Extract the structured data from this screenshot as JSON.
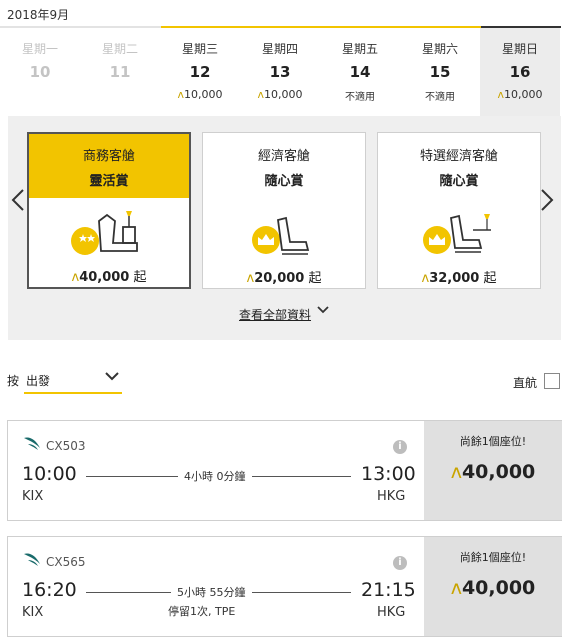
{
  "calendar": {
    "month": "2018年9月",
    "days": [
      {
        "name": "星期一",
        "num": "10",
        "price": "",
        "disabled": true
      },
      {
        "name": "星期二",
        "num": "11",
        "price": "",
        "disabled": true
      },
      {
        "name": "星期三",
        "num": "12",
        "price": "10,000",
        "disabled": false
      },
      {
        "name": "星期四",
        "num": "13",
        "price": "10,000",
        "disabled": false
      },
      {
        "name": "星期五",
        "num": "14",
        "price": "不適用",
        "disabled": false
      },
      {
        "name": "星期六",
        "num": "15",
        "price": "不適用",
        "disabled": false
      },
      {
        "name": "星期日",
        "num": "16",
        "price": "10,000",
        "disabled": false
      }
    ]
  },
  "cabins": [
    {
      "name": "商務客艙",
      "award": "靈活賞",
      "price": "40,000",
      "suffix": "起",
      "icon": "business-seat-star-icon"
    },
    {
      "name": "經濟客艙",
      "award": "隨心賞",
      "price": "20,000",
      "suffix": "起",
      "icon": "economy-seat-crown-icon"
    },
    {
      "name": "特選經濟客艙",
      "award": "隨心賞",
      "price": "32,000",
      "suffix": "起",
      "icon": "premium-economy-seat-crown-icon"
    }
  ],
  "view_all": "查看全部資料",
  "sort": {
    "label": "按",
    "value": "出發"
  },
  "nonstop": {
    "label": "直航"
  },
  "flights": [
    {
      "number": "CX503",
      "dep_time": "10:00",
      "dep_code": "KIX",
      "arr_time": "13:00",
      "arr_code": "HKG",
      "duration": "4小時 0分鐘",
      "stops": "",
      "seats": "尚餘1個座位!",
      "price": "40,000"
    },
    {
      "number": "CX565",
      "dep_time": "16:20",
      "dep_code": "KIX",
      "arr_time": "21:15",
      "arr_code": "HKG",
      "duration": "5小時 55分鐘",
      "stops": "停留1次, TPE",
      "seats": "尚餘1個座位!",
      "price": "40,000"
    }
  ],
  "colors": {
    "accent": "#f2c400",
    "selected_bg": "#ececec",
    "fare_bg": "#e0e0e0"
  }
}
